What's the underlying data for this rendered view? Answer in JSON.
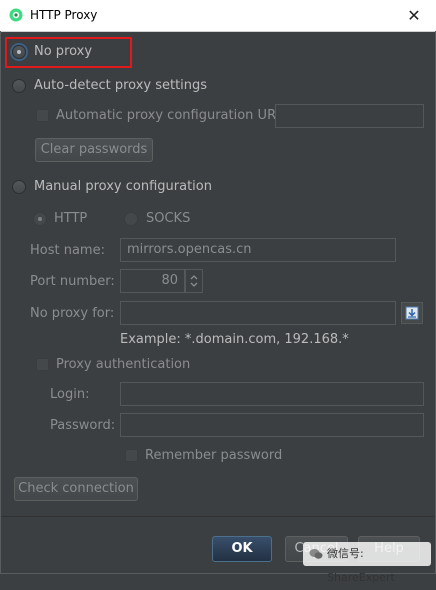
{
  "window": {
    "title": "HTTP Proxy",
    "close_glyph": "✕"
  },
  "modes": {
    "no_proxy": "No proxy",
    "auto_detect": "Auto-detect proxy settings",
    "manual": "Manual proxy configuration",
    "selected": "no_proxy"
  },
  "auto": {
    "pac_label": "Automatic proxy configuration URL:",
    "pac_value": "",
    "clear_passwords": "Clear passwords"
  },
  "manual": {
    "http_label": "HTTP",
    "socks_label": "SOCKS",
    "host_label": "Host name:",
    "host_value": "mirrors.opencas.cn",
    "port_label": "Port number:",
    "port_value": "80",
    "no_proxy_for_label": "No proxy for:",
    "no_proxy_for_value": "",
    "example": "Example: *.domain.com, 192.168.*",
    "auth_label": "Proxy authentication",
    "login_label": "Login:",
    "login_value": "",
    "password_label": "Password:",
    "password_value": "",
    "remember_label": "Remember password"
  },
  "buttons": {
    "check_connection": "Check connection",
    "ok": "OK",
    "cancel": "Cancel",
    "help": "Help"
  },
  "watermark": {
    "text": "微信号: ShareExpert"
  },
  "colors": {
    "background": "#3c3f41",
    "text": "#bbbbbb",
    "disabled_text": "#8a8c8e",
    "highlight": "#e0191b",
    "primary_button": "#365880"
  },
  "icons": {
    "app": "android-studio-icon",
    "expand_list": "expand-list-icon",
    "spinner": "spinner-arrows-icon"
  }
}
